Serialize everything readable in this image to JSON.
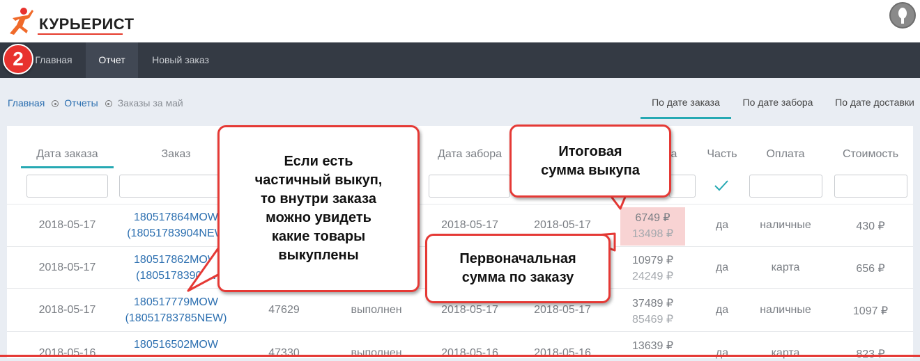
{
  "header": {
    "logo_text": "КУРЬЕРИСТ"
  },
  "badge": "2",
  "nav": {
    "items": [
      {
        "label": "Главная"
      },
      {
        "label": "Отчет"
      },
      {
        "label": "Новый заказ"
      }
    ],
    "active": "Отчет"
  },
  "breadcrumb": {
    "home": "Главная",
    "reports": "Отчеты",
    "current": "Заказы за май"
  },
  "view_tabs": [
    {
      "label": "По дате заказа"
    },
    {
      "label": "По дате забора"
    },
    {
      "label": "По дате доставки"
    }
  ],
  "table": {
    "columns": {
      "order_date": "Дата заказа",
      "order": "Заказ",
      "pickup_date": "Дата забора",
      "amount_partial": "а",
      "part": "Часть",
      "payment": "Оплата",
      "cost": "Стоимость"
    },
    "rows": [
      {
        "order_date": "2018-05-17",
        "order_id": "180517864MOW",
        "order_sub": "(18051783904NEW",
        "num": "",
        "status": "",
        "pickup_date": "2018-05-17",
        "delivery_date": "2018-05-17",
        "amount": "6749 ₽",
        "original": "13498 ₽",
        "part": "да",
        "payment": "наличные",
        "cost": "430 ₽"
      },
      {
        "order_date": "2018-05-17",
        "order_id": "180517862MOW",
        "order_sub": "(18051783903N",
        "num": "",
        "status": "",
        "pickup_date": "",
        "delivery_date": "",
        "amount": "10979 ₽",
        "original": "24249 ₽",
        "part": "да",
        "payment": "карта",
        "cost": "656 ₽"
      },
      {
        "order_date": "2018-05-17",
        "order_id": "180517779MOW",
        "order_sub": "(18051783785NEW)",
        "num": "47629",
        "status": "выполнен",
        "pickup_date": "2018-05-17",
        "delivery_date": "2018-05-17",
        "amount": "37489 ₽",
        "original": "85469 ₽",
        "part": "да",
        "payment": "наличные",
        "cost": "1097 ₽"
      },
      {
        "order_date": "2018-05-16",
        "order_id": "180516502MOW",
        "order_sub": "",
        "num": "47330",
        "status": "выполнен",
        "pickup_date": "2018-05-16",
        "delivery_date": "2018-05-16",
        "amount": "13639 ₽",
        "original": "",
        "part": "да",
        "payment": "карта",
        "cost": "823 ₽"
      }
    ]
  },
  "callouts": {
    "partial": "Если есть\nчастичный выкуп,\nто внутри заказа\nможно увидеть\nкакие товары\nвыкуплены",
    "total": "Итоговая\nсумма выкупа",
    "original": "Первоначальная\nсумма по заказу"
  },
  "colors": {
    "accent": "#26a9b3",
    "link": "#2c6fb0",
    "callout_border": "#e53935",
    "navbar": "#343a44",
    "highlight": "#f8d3d3"
  }
}
